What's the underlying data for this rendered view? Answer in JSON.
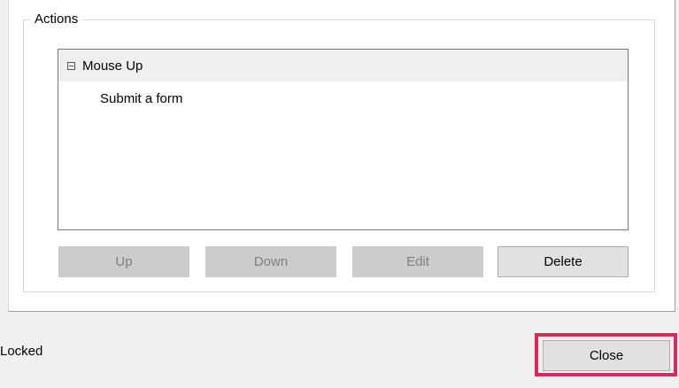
{
  "actions_group": {
    "title": "Actions",
    "list": {
      "header": {
        "label": "Mouse Up",
        "icon": "collapse-icon"
      },
      "items": [
        {
          "label": "Submit a form"
        }
      ]
    },
    "buttons": {
      "up": {
        "label": "Up",
        "enabled": false
      },
      "down": {
        "label": "Down",
        "enabled": false
      },
      "edit": {
        "label": "Edit",
        "enabled": false
      },
      "delete": {
        "label": "Delete",
        "enabled": true
      }
    }
  },
  "footer": {
    "status": "Locked",
    "close_label": "Close",
    "highlight_color": "#e0245e"
  }
}
